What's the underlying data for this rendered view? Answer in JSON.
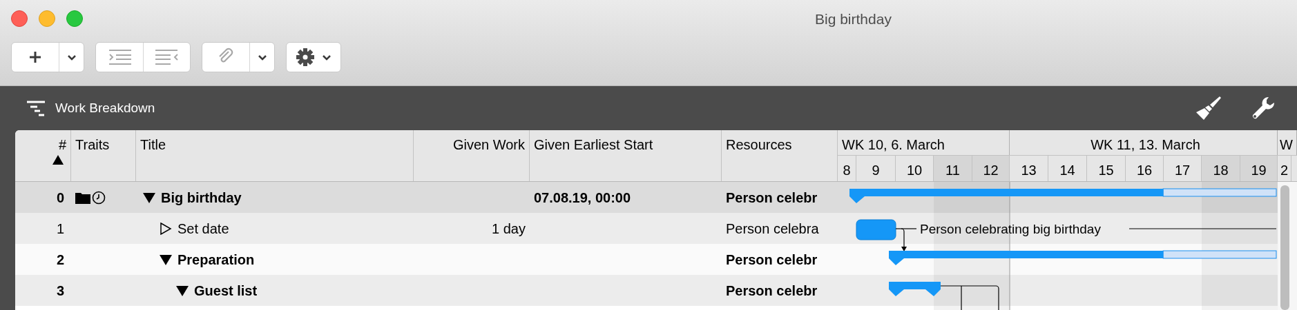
{
  "window": {
    "title": "Big birthday"
  },
  "panel": {
    "title": "Work Breakdown"
  },
  "table": {
    "columns": [
      {
        "label": "#",
        "sorted": true
      },
      {
        "label": "Traits",
        "sorted": false
      },
      {
        "label": "Title",
        "sorted": false
      },
      {
        "label": "Given Work",
        "sorted": false
      },
      {
        "label": "Given Earliest Start",
        "sorted": false
      },
      {
        "label": "Resources",
        "sorted": false
      }
    ],
    "rows": [
      {
        "number": "0",
        "kind": "group",
        "traits_shown": true,
        "title": "Big birthday",
        "expanded": true,
        "given_earliest_start": "07.08.19, 00:00",
        "resources": "Person celebr",
        "bar": {
          "kind": "summary",
          "level": 0.735
        },
        "children": [
          {
            "number": "1",
            "kind": "task",
            "traits_shown": false,
            "title": "Set date",
            "expanded": false,
            "given_work": "1 day",
            "resources": "Person celebra",
            "bar": {
              "kind": "task",
              "label": "Person celebrating big birthday"
            }
          },
          {
            "number": "2",
            "kind": "group",
            "traits_shown": false,
            "title": "Preparation",
            "expanded": true,
            "resources": "Person celebr",
            "bar": {
              "kind": "summary",
              "level": 0.708
            },
            "children": [
              {
                "number": "3",
                "kind": "group",
                "traits_shown": false,
                "title": "Guest list",
                "expanded": true,
                "resources": "Person celebr",
                "bar": {
                  "kind": "summary",
                  "level": 1
                }
              }
            ]
          }
        ]
      }
    ]
  },
  "timeline": {
    "weeks": [
      {
        "label": "WK 10, 6. March"
      },
      {
        "label": "WK 11, 13. March"
      },
      {
        "label": "W"
      }
    ],
    "days": [
      {
        "label": "8",
        "weekend": false
      },
      {
        "label": "9",
        "weekend": false
      },
      {
        "label": "10",
        "weekend": false
      },
      {
        "label": "11",
        "weekend": true
      },
      {
        "label": "12",
        "weekend": true
      },
      {
        "label": "13",
        "weekend": false
      },
      {
        "label": "14",
        "weekend": false
      },
      {
        "label": "15",
        "weekend": false
      },
      {
        "label": "16",
        "weekend": false
      },
      {
        "label": "17",
        "weekend": false
      },
      {
        "label": "18",
        "weekend": true
      },
      {
        "label": "19",
        "weekend": true
      },
      {
        "label": "2",
        "weekend": false
      }
    ]
  }
}
